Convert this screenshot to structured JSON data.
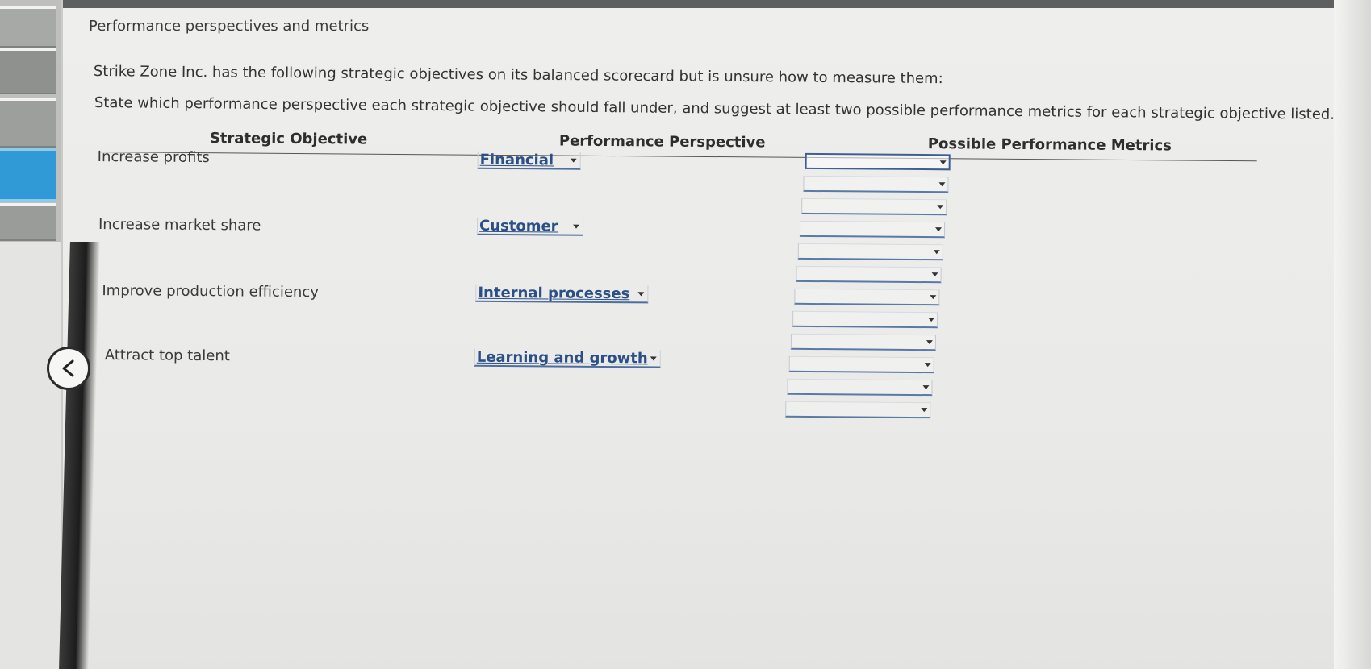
{
  "page": {
    "title": "Performance perspectives and metrics",
    "intro": "Strike Zone Inc. has the following strategic objectives on its balanced scorecard but is unsure how to measure them:",
    "instructions": "State which performance perspective each strategic objective should fall under, and suggest at least two possible performance metrics for each strategic objective listed."
  },
  "table": {
    "headers": {
      "objective": "Strategic Objective",
      "perspective": "Performance Perspective",
      "metrics": "Possible Performance Metrics"
    },
    "rows": [
      {
        "objective": "Increase profits",
        "perspective": "Financial"
      },
      {
        "objective": "Increase market share",
        "perspective": "Customer"
      },
      {
        "objective": "Improve production efficiency",
        "perspective": "Internal processes"
      },
      {
        "objective": "Attract top talent",
        "perspective": "Learning and growth"
      }
    ],
    "metric_dropdowns": [
      "",
      "",
      "",
      "",
      "",
      "",
      "",
      "",
      "",
      "",
      "",
      ""
    ]
  },
  "icons": {
    "back": "chevron-left-icon",
    "dropdown": "chevron-down-icon"
  },
  "colors": {
    "select_text": "#2b4f86",
    "active_tab": "#2f9ad6"
  }
}
